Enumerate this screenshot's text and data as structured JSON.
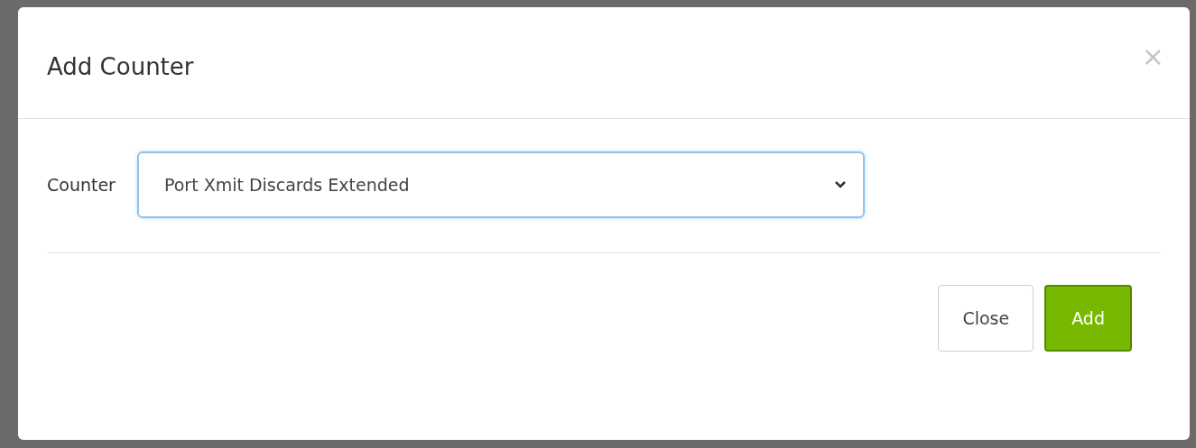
{
  "dialog": {
    "title": "Add Counter",
    "close_icon": "×"
  },
  "field": {
    "label": "Counter",
    "value": "Port Xmit Discards Extended"
  },
  "buttons": [
    {
      "label": "Close",
      "kind": "secondary"
    },
    {
      "label": "Add",
      "kind": "primary"
    }
  ]
}
